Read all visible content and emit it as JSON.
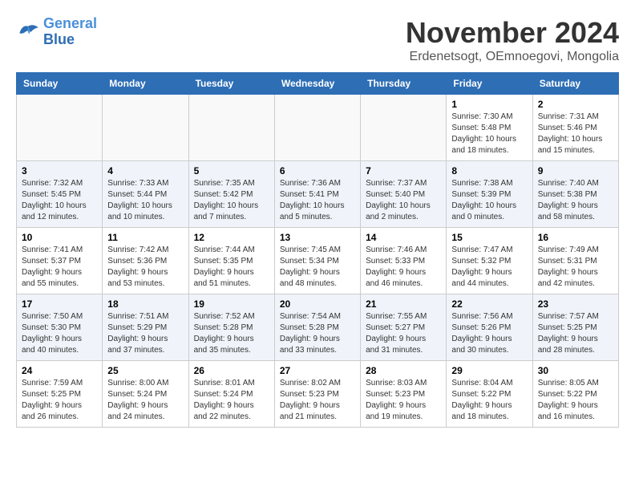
{
  "logo": {
    "line1": "General",
    "line2": "Blue"
  },
  "title": "November 2024",
  "subtitle": "Erdenetsogt, OEmnoegovi, Mongolia",
  "weekdays": [
    "Sunday",
    "Monday",
    "Tuesday",
    "Wednesday",
    "Thursday",
    "Friday",
    "Saturday"
  ],
  "weeks": [
    [
      {
        "day": "",
        "info": ""
      },
      {
        "day": "",
        "info": ""
      },
      {
        "day": "",
        "info": ""
      },
      {
        "day": "",
        "info": ""
      },
      {
        "day": "",
        "info": ""
      },
      {
        "day": "1",
        "info": "Sunrise: 7:30 AM\nSunset: 5:48 PM\nDaylight: 10 hours and 18 minutes."
      },
      {
        "day": "2",
        "info": "Sunrise: 7:31 AM\nSunset: 5:46 PM\nDaylight: 10 hours and 15 minutes."
      }
    ],
    [
      {
        "day": "3",
        "info": "Sunrise: 7:32 AM\nSunset: 5:45 PM\nDaylight: 10 hours and 12 minutes."
      },
      {
        "day": "4",
        "info": "Sunrise: 7:33 AM\nSunset: 5:44 PM\nDaylight: 10 hours and 10 minutes."
      },
      {
        "day": "5",
        "info": "Sunrise: 7:35 AM\nSunset: 5:42 PM\nDaylight: 10 hours and 7 minutes."
      },
      {
        "day": "6",
        "info": "Sunrise: 7:36 AM\nSunset: 5:41 PM\nDaylight: 10 hours and 5 minutes."
      },
      {
        "day": "7",
        "info": "Sunrise: 7:37 AM\nSunset: 5:40 PM\nDaylight: 10 hours and 2 minutes."
      },
      {
        "day": "8",
        "info": "Sunrise: 7:38 AM\nSunset: 5:39 PM\nDaylight: 10 hours and 0 minutes."
      },
      {
        "day": "9",
        "info": "Sunrise: 7:40 AM\nSunset: 5:38 PM\nDaylight: 9 hours and 58 minutes."
      }
    ],
    [
      {
        "day": "10",
        "info": "Sunrise: 7:41 AM\nSunset: 5:37 PM\nDaylight: 9 hours and 55 minutes."
      },
      {
        "day": "11",
        "info": "Sunrise: 7:42 AM\nSunset: 5:36 PM\nDaylight: 9 hours and 53 minutes."
      },
      {
        "day": "12",
        "info": "Sunrise: 7:44 AM\nSunset: 5:35 PM\nDaylight: 9 hours and 51 minutes."
      },
      {
        "day": "13",
        "info": "Sunrise: 7:45 AM\nSunset: 5:34 PM\nDaylight: 9 hours and 48 minutes."
      },
      {
        "day": "14",
        "info": "Sunrise: 7:46 AM\nSunset: 5:33 PM\nDaylight: 9 hours and 46 minutes."
      },
      {
        "day": "15",
        "info": "Sunrise: 7:47 AM\nSunset: 5:32 PM\nDaylight: 9 hours and 44 minutes."
      },
      {
        "day": "16",
        "info": "Sunrise: 7:49 AM\nSunset: 5:31 PM\nDaylight: 9 hours and 42 minutes."
      }
    ],
    [
      {
        "day": "17",
        "info": "Sunrise: 7:50 AM\nSunset: 5:30 PM\nDaylight: 9 hours and 40 minutes."
      },
      {
        "day": "18",
        "info": "Sunrise: 7:51 AM\nSunset: 5:29 PM\nDaylight: 9 hours and 37 minutes."
      },
      {
        "day": "19",
        "info": "Sunrise: 7:52 AM\nSunset: 5:28 PM\nDaylight: 9 hours and 35 minutes."
      },
      {
        "day": "20",
        "info": "Sunrise: 7:54 AM\nSunset: 5:28 PM\nDaylight: 9 hours and 33 minutes."
      },
      {
        "day": "21",
        "info": "Sunrise: 7:55 AM\nSunset: 5:27 PM\nDaylight: 9 hours and 31 minutes."
      },
      {
        "day": "22",
        "info": "Sunrise: 7:56 AM\nSunset: 5:26 PM\nDaylight: 9 hours and 30 minutes."
      },
      {
        "day": "23",
        "info": "Sunrise: 7:57 AM\nSunset: 5:25 PM\nDaylight: 9 hours and 28 minutes."
      }
    ],
    [
      {
        "day": "24",
        "info": "Sunrise: 7:59 AM\nSunset: 5:25 PM\nDaylight: 9 hours and 26 minutes."
      },
      {
        "day": "25",
        "info": "Sunrise: 8:00 AM\nSunset: 5:24 PM\nDaylight: 9 hours and 24 minutes."
      },
      {
        "day": "26",
        "info": "Sunrise: 8:01 AM\nSunset: 5:24 PM\nDaylight: 9 hours and 22 minutes."
      },
      {
        "day": "27",
        "info": "Sunrise: 8:02 AM\nSunset: 5:23 PM\nDaylight: 9 hours and 21 minutes."
      },
      {
        "day": "28",
        "info": "Sunrise: 8:03 AM\nSunset: 5:23 PM\nDaylight: 9 hours and 19 minutes."
      },
      {
        "day": "29",
        "info": "Sunrise: 8:04 AM\nSunset: 5:22 PM\nDaylight: 9 hours and 18 minutes."
      },
      {
        "day": "30",
        "info": "Sunrise: 8:05 AM\nSunset: 5:22 PM\nDaylight: 9 hours and 16 minutes."
      }
    ]
  ]
}
